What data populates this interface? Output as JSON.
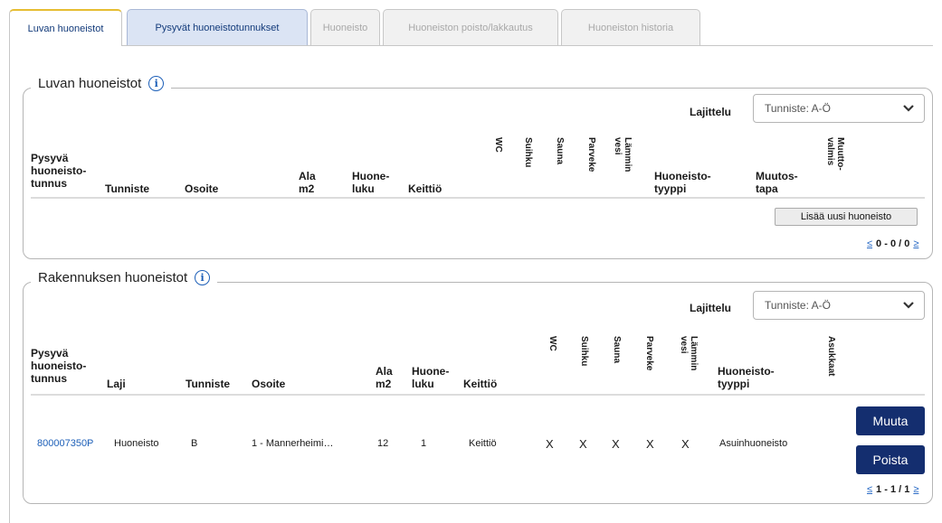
{
  "tabs": [
    {
      "label": "Luvan huoneistot",
      "state": "active"
    },
    {
      "label": "Pysyvät huoneistotunnukset",
      "state": "enabled"
    },
    {
      "label": "Huoneisto",
      "state": "disabled"
    },
    {
      "label": "Huoneiston poisto/lakkautus",
      "state": "disabled"
    },
    {
      "label": "Huoneiston historia",
      "state": "disabled"
    }
  ],
  "luvan": {
    "title": "Luvan huoneistot",
    "info_icon": "info-icon",
    "sort_label": "Lajittelu",
    "sort_value": "Tunniste: A-Ö",
    "headers": {
      "pysyva_1": "Pysyvä",
      "pysyva_2": "huoneisto-",
      "pysyva_3": "tunnus",
      "tunniste": "Tunniste",
      "osoite": "Osoite",
      "ala_1": "Ala",
      "ala_2": "m2",
      "huone_1": "Huone-",
      "huone_2": "luku",
      "keittio": "Keittiö",
      "wc": "WC",
      "suihku": "Suihku",
      "sauna": "Sauna",
      "parveke": "Parveke",
      "lammin": "Lämmin vesi",
      "tyyppi_1": "Huoneisto-",
      "tyyppi_2": "tyyppi",
      "muutos_1": "Muutos-",
      "muutos_2": "tapa",
      "muutto": "Muutto- valmis"
    },
    "add_button": "Lisää uusi huoneisto",
    "pager_text": "0 - 0 / 0"
  },
  "rakennus": {
    "title": "Rakennuksen huoneistot",
    "sort_label": "Lajittelu",
    "sort_value": "Tunniste: A-Ö",
    "headers": {
      "pysyva_1": "Pysyvä",
      "pysyva_2": "huoneisto-",
      "pysyva_3": "tunnus",
      "laji": "Laji",
      "tunniste": "Tunniste",
      "osoite": "Osoite",
      "ala_1": "Ala",
      "ala_2": "m2",
      "huone_1": "Huone-",
      "huone_2": "luku",
      "keittio": "Keittiö",
      "wc": "WC",
      "suihku": "Suihku",
      "sauna": "Sauna",
      "parveke": "Parveke",
      "lammin": "Lämmin vesi",
      "tyyppi_1": "Huoneisto-",
      "tyyppi_2": "tyyppi",
      "asukas": "Asukkaat"
    },
    "row": {
      "tunnus": "800007350P",
      "laji": "Huoneisto",
      "tunniste": "B",
      "osoite": "1 - Mannerheimi…",
      "ala": "12",
      "huoneluku": "1",
      "keittio": "Keittiö",
      "wc": "X",
      "suihku": "X",
      "sauna": "X",
      "parveke": "X",
      "lamminvesi": "X",
      "tyyppi": "Asuinhuoneisto"
    },
    "edit_button": "Muuta",
    "delete_button": "Poista",
    "pager_text": "1 - 1 / 1"
  },
  "pager": {
    "prev": "≤",
    "next": "≥"
  }
}
